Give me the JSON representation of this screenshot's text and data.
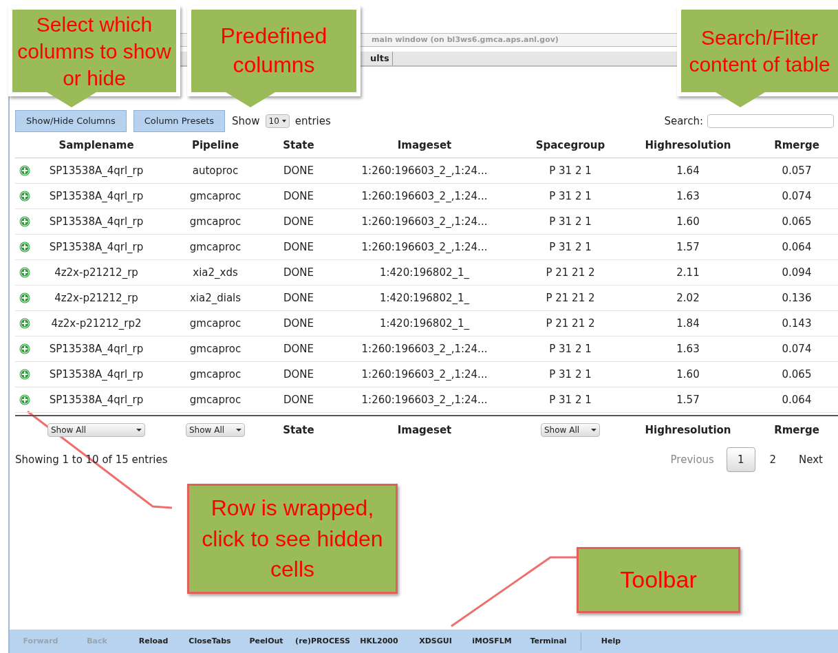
{
  "window": {
    "title": "main window  (on bl3ws6.gmca.aps.anl.gov)"
  },
  "tabs": [
    {
      "label": "ults",
      "selected": false
    }
  ],
  "controls": {
    "buttons": [
      "Show/Hide Columns",
      "Column Presets"
    ],
    "length_prefix": "Show",
    "length_value": "10",
    "length_suffix": "entries",
    "search_label": "Search:"
  },
  "table": {
    "columns": [
      "Samplename",
      "Pipeline",
      "State",
      "Imageset",
      "Spacegroup",
      "Highresolution",
      "Rmerge"
    ],
    "rows": [
      {
        "expanded": false,
        "cells": [
          "SP13538A_4qrl_rp",
          "autoproc",
          "DONE",
          "1:260:196603_2_,1:24...",
          "P 31 2 1",
          "1.64",
          "0.057"
        ]
      },
      {
        "expanded": false,
        "cells": [
          "SP13538A_4qrl_rp",
          "gmcaproc",
          "DONE",
          "1:260:196603_2_,1:24...",
          "P 31 2 1",
          "1.63",
          "0.074"
        ]
      },
      {
        "expanded": false,
        "cells": [
          "SP13538A_4qrl_rp",
          "gmcaproc",
          "DONE",
          "1:260:196603_2_,1:24...",
          "P 31 2 1",
          "1.60",
          "0.065"
        ]
      },
      {
        "expanded": false,
        "cells": [
          "SP13538A_4qrl_rp",
          "gmcaproc",
          "DONE",
          "1:260:196603_2_,1:24...",
          "P 31 2 1",
          "1.57",
          "0.064"
        ]
      },
      {
        "expanded": false,
        "cells": [
          "4z2x-p21212_rp",
          "xia2_xds",
          "DONE",
          "1:420:196802_1_",
          "P 21 21 2",
          "2.11",
          "0.094"
        ]
      },
      {
        "expanded": false,
        "cells": [
          "4z2x-p21212_rp",
          "xia2_dials",
          "DONE",
          "1:420:196802_1_",
          "P 21 21 2",
          "2.02",
          "0.136"
        ]
      },
      {
        "expanded": false,
        "cells": [
          "4z2x-p21212_rp2",
          "gmcaproc",
          "DONE",
          "1:420:196802_1_",
          "P 21 21 2",
          "1.84",
          "0.143"
        ]
      },
      {
        "expanded": false,
        "cells": [
          "SP13538A_4qrl_rp",
          "gmcaproc",
          "DONE",
          "1:260:196603_2_,1:24...",
          "P 31 2 1",
          "1.63",
          "0.074"
        ]
      },
      {
        "expanded": false,
        "cells": [
          "SP13538A_4qrl_rp",
          "gmcaproc",
          "DONE",
          "1:260:196603_2_,1:24...",
          "P 31 2 1",
          "1.60",
          "0.065"
        ]
      },
      {
        "expanded": false,
        "cells": [
          "SP13538A_4qrl_rp",
          "gmcaproc",
          "DONE",
          "1:260:196603_2_,1:24...",
          "P 31 2 1",
          "1.57",
          "0.064"
        ]
      }
    ],
    "footer": [
      {
        "kind": "select",
        "text": "Show All"
      },
      {
        "kind": "select",
        "text": "Show All"
      },
      {
        "kind": "label",
        "text": "State"
      },
      {
        "kind": "label",
        "text": "Imageset"
      },
      {
        "kind": "select",
        "text": "Show All"
      },
      {
        "kind": "label",
        "text": "Highresolution"
      },
      {
        "kind": "label",
        "text": "Rmerge"
      }
    ]
  },
  "info": "Showing 1 to 10 of 15 entries",
  "pagination": [
    {
      "label": "Previous",
      "kind": "nav",
      "disabled": true,
      "selected": false
    },
    {
      "label": "1",
      "kind": "page",
      "disabled": false,
      "selected": true
    },
    {
      "label": "2",
      "kind": "page",
      "disabled": false,
      "selected": false
    },
    {
      "label": "Next",
      "kind": "nav",
      "disabled": false,
      "selected": false
    }
  ],
  "toolbar": [
    {
      "label": "Forward",
      "disabled": true
    },
    {
      "label": "Back",
      "disabled": true
    },
    {
      "label": "Reload",
      "disabled": false
    },
    {
      "label": "CloseTabs",
      "disabled": false
    },
    {
      "label": "PeelOut",
      "disabled": false
    },
    {
      "label": "(re)PROCESS",
      "disabled": false
    },
    {
      "label": "HKL2000",
      "disabled": false
    },
    {
      "label": "XDSGUI",
      "disabled": false
    },
    {
      "label": "iMOSFLM",
      "disabled": false
    },
    {
      "label": "Terminal",
      "disabled": false
    },
    {
      "label": "Help",
      "disabled": false
    }
  ],
  "callouts": [
    {
      "kind": "tooltip",
      "text": "Select which columns to show or hide"
    },
    {
      "kind": "tooltip",
      "text": "Predefined columns"
    },
    {
      "kind": "tooltip",
      "text": "Search/Filter content of table"
    },
    {
      "kind": "box",
      "text": "Row is wrapped, click to see hidden cells"
    },
    {
      "kind": "box",
      "text": "Toolbar"
    }
  ]
}
